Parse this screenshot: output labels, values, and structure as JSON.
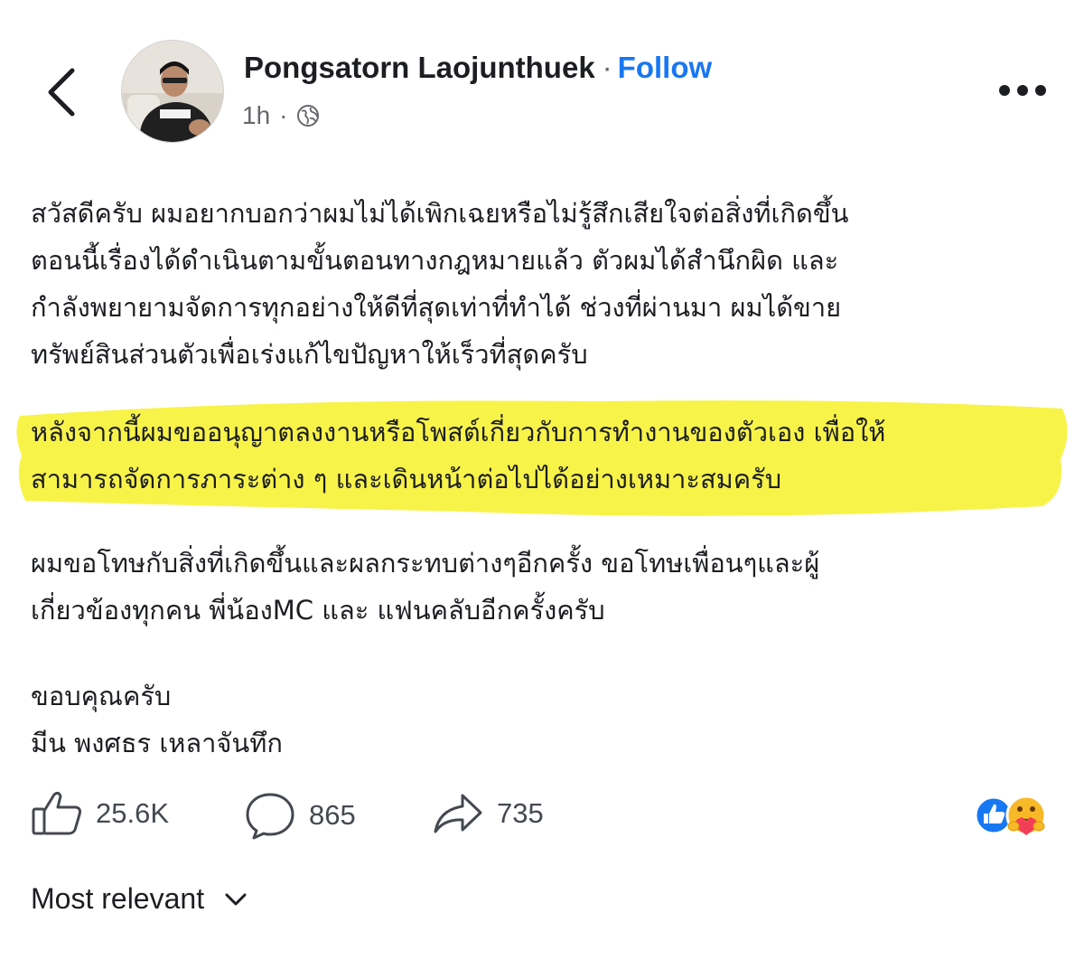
{
  "post": {
    "author_name": "Pongsatorn Laojunthuek",
    "separator": "·",
    "follow_label": "Follow",
    "time": "1h",
    "meta_separator": "·",
    "privacy_icon": "globe-icon",
    "paragraphs": [
      [
        "สวัสดีครับ ผมอยากบอกว่าผมไม่ได้เพิกเฉยหรือไม่รู้สึกเสียใจต่อสิ่งที่เกิดขึ้น",
        "ตอนนี้เรื่องได้ดำเนินตามขั้นตอนทางกฎหมายแล้ว ตัวผมได้สำนึกผิด และ",
        "กำลังพยายามจัดการทุกอย่างให้ดีที่สุดเท่าที่ทำได้ ช่วงที่ผ่านมา ผมได้ขาย",
        "ทรัพย์สินส่วนตัวเพื่อเร่งแก้ไขปัญหาให้เร็วที่สุดครับ"
      ],
      [
        "หลังจากนี้ผมขออนุญาตลงงานหรือโพสต์เกี่ยวกับการทำงานของตัวเอง เพื่อให้",
        "สามารถจัดการภาระต่าง ๆ และเดินหน้าต่อไปได้อย่างเหมาะสมครับ"
      ],
      [
        "ผมขอโทษกับสิ่งที่เกิดขึ้นและผลกระทบต่างๆอีกครั้ง ขอโทษเพื่อนๆและผู้",
        "เกี่ยวข้องทุกคน พี่น้องMC และ แฟนคลับอีกครั้งครับ"
      ],
      [
        "ขอบคุณครับ",
        "มีน พงศธร เหลาจันทึก"
      ]
    ]
  },
  "engagement": {
    "likes": "25.6K",
    "comments": "865",
    "shares": "735"
  },
  "comments_sort": {
    "label": "Most relevant"
  },
  "colors": {
    "follow_blue": "#1877f2",
    "highlight_yellow": "#f7f23a",
    "secondary_text": "#65676b",
    "like_blue": "#1877f2",
    "care_yellow": "#f7b928"
  },
  "icons": {
    "back": "chevron-left-icon",
    "more": "more-dots-icon",
    "like": "thumbs-up-icon",
    "comment": "comment-bubble-icon",
    "share": "share-arrow-icon",
    "reaction_like": "like-reaction-icon",
    "reaction_care": "care-reaction-icon",
    "sort": "chevron-down-icon"
  }
}
